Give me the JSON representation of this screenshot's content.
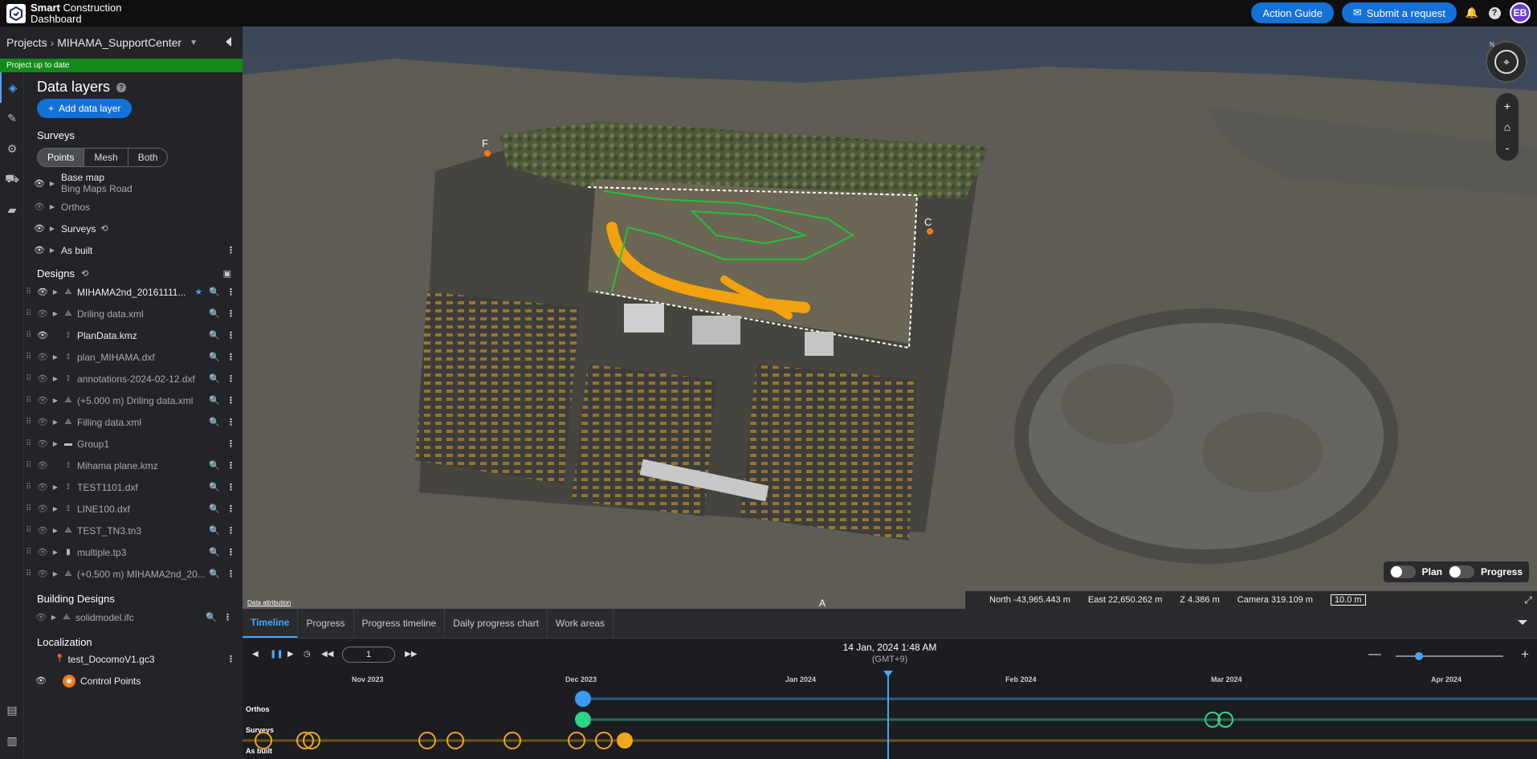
{
  "app": {
    "title_bold": "Smart",
    "title_rest": " Construction",
    "title_line2": "Dashboard",
    "action_guide": "Action Guide",
    "submit_request": "Submit a request",
    "avatar_initials": "EB"
  },
  "project": {
    "breadcrumb_root": "Projects",
    "name": "MIHAMA_SupportCenter",
    "status": "Project up to date"
  },
  "panel": {
    "title": "Data layers",
    "add_button": "Add data layer",
    "surveys_title": "Surveys",
    "view_modes": [
      "Points",
      "Mesh",
      "Both"
    ],
    "active_view_mode": "Points",
    "survey_layers": [
      {
        "name": "Base map",
        "sub": "Bing Maps Road",
        "visible": true
      },
      {
        "name": "Orthos",
        "visible": false
      },
      {
        "name": "Surveys",
        "visible": true
      },
      {
        "name": "As built",
        "visible": true
      }
    ],
    "designs_title": "Designs",
    "designs": [
      {
        "name": "MIHAMA2nd_20161111...",
        "visible": true,
        "type": "tin"
      },
      {
        "name": "Driling data.xml",
        "visible": false,
        "type": "tin"
      },
      {
        "name": "PlanData.kmz",
        "visible": true,
        "type": "line"
      },
      {
        "name": "plan_MIHAMA.dxf",
        "visible": false,
        "type": "line"
      },
      {
        "name": "annotations-2024-02-12.dxf",
        "visible": false,
        "type": "line"
      },
      {
        "name": "(+5.000 m) Driling data.xml",
        "visible": false,
        "type": "tin"
      },
      {
        "name": "Filling data.xml",
        "visible": false,
        "type": "tin"
      },
      {
        "name": "Group1",
        "visible": false,
        "type": "folder"
      },
      {
        "name": "Mihama plane.kmz",
        "visible": false,
        "type": "line"
      },
      {
        "name": "TEST1101.dxf",
        "visible": false,
        "type": "line"
      },
      {
        "name": "LINE100.dxf",
        "visible": false,
        "type": "line"
      },
      {
        "name": "TEST_TN3.tn3",
        "visible": false,
        "type": "tin"
      },
      {
        "name": "multiple.tp3",
        "visible": false,
        "type": "file"
      },
      {
        "name": "(+0.500 m) MIHAMA2nd_20...",
        "visible": false,
        "type": "tin"
      }
    ],
    "building_title": "Building Designs",
    "building_items": [
      {
        "name": "solidmodel.ifc"
      }
    ],
    "localization_title": "Localization",
    "localization_file": "test_DocomoV1.gc3",
    "control_points": "Control Points"
  },
  "viewport": {
    "attribution": "Data attribution",
    "plan_label": "Plan",
    "progress_label": "Progress",
    "north": "North -43,965.443 m",
    "east": "East 22,650.262 m",
    "z": "Z 4.386 m",
    "camera": "Camera 319.109 m",
    "scale": "10.0 m",
    "compass_n": "N",
    "marker_a": "A",
    "marker_f": "F",
    "marker_c": "C"
  },
  "timeline": {
    "tabs": [
      "Timeline",
      "Progress",
      "Progress timeline",
      "Daily progress chart",
      "Work areas"
    ],
    "active_tab": "Timeline",
    "speed": "1",
    "datetime": "14 Jan, 2024 1:48 AM",
    "timezone": "(GMT+9)",
    "months": [
      "Nov 2023",
      "Dec 2023",
      "Jan 2024",
      "Feb 2024",
      "Mar 2024",
      "Apr 2024"
    ],
    "tracks": [
      "Orthos",
      "Surveys",
      "As built"
    ],
    "zoom_level": 0.22
  },
  "colors": {
    "accent": "#1471d8",
    "status": "#138a1a",
    "orthos": "#3a9bf0",
    "surveys": "#2fd38a",
    "asbuilt": "#f0a81a"
  }
}
